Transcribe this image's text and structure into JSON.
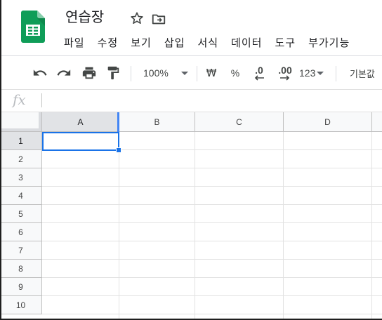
{
  "header": {
    "doc_title": "연습장",
    "menu": [
      "파일",
      "수정",
      "보기",
      "삽입",
      "서식",
      "데이터",
      "도구",
      "부가기능"
    ]
  },
  "toolbar": {
    "zoom": "100%",
    "currency_symbol": "₩",
    "percent_symbol": "%",
    "decrease_decimal": ".0",
    "increase_decimal": ".00",
    "more_formats": "123",
    "font_label": "기본값"
  },
  "formula_bar": {
    "fx_label": "fx",
    "value": ""
  },
  "grid": {
    "columns": [
      "A",
      "B",
      "C",
      "D"
    ],
    "rows": [
      "1",
      "2",
      "3",
      "4",
      "5",
      "6",
      "7",
      "8",
      "9",
      "10"
    ],
    "selected_cell": "A1"
  },
  "colors": {
    "accent": "#1a73e8",
    "logo_green": "#0f9d58",
    "header_bg": "#f8f9fa",
    "active_header_bg": "#e1e3e6"
  },
  "icons": {
    "app": "sheets-logo-icon",
    "star": "star-icon",
    "move": "move-to-folder-icon",
    "undo": "undo-icon",
    "redo": "redo-icon",
    "print": "print-icon",
    "paint_format": "paint-format-icon"
  }
}
